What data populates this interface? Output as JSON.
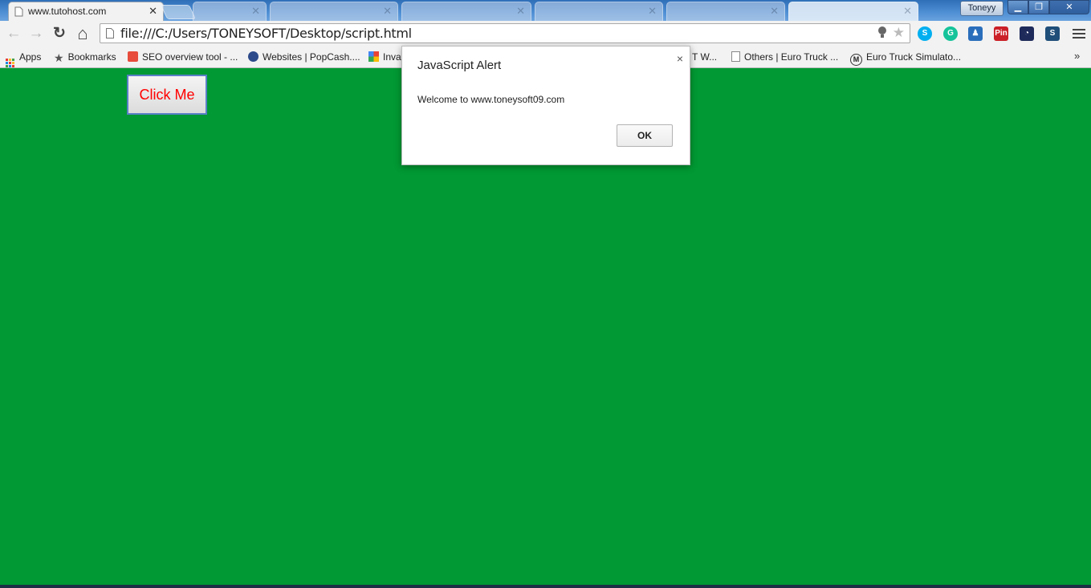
{
  "window": {
    "profile_name": "Toneyy",
    "minimize_symbol": "▁",
    "maximize_symbol": "❐",
    "close_symbol": "✕"
  },
  "tabs": [
    {
      "title": "www.tutohost.com",
      "active": true
    },
    {
      "title": "",
      "active": false
    },
    {
      "title": "",
      "active": false
    },
    {
      "title": "",
      "active": false
    },
    {
      "title": "",
      "active": false
    },
    {
      "title": "",
      "active": false
    },
    {
      "title": "",
      "active": false
    }
  ],
  "toolbar": {
    "back_symbol": "←",
    "forward_symbol": "→",
    "reload_symbol": "↻",
    "home_symbol": "⌂",
    "url": "file:///C:/Users/TONEYSOFT/Desktop/script.html",
    "bulb_symbol": "💡",
    "star_symbol": "★",
    "extensions": [
      {
        "name": "skype-extension-icon",
        "label": "S",
        "color": "#00aff0"
      },
      {
        "name": "grammarly-extension-icon",
        "label": "G",
        "color": "#15c39a"
      },
      {
        "name": "user-extension-icon",
        "label": "♟",
        "color": "#2a6ebb"
      },
      {
        "name": "pinterest-extension-icon",
        "label": "Pin",
        "color": "#cb2027"
      },
      {
        "name": "speedometer-extension-icon",
        "label": "◔",
        "color": "#1e2a5a"
      },
      {
        "name": "s-extension-icon",
        "label": "S",
        "color": "#1f4e79"
      }
    ]
  },
  "bookmarks": {
    "apps": "Apps",
    "items": [
      {
        "label": "Bookmarks",
        "icon": "star-icon"
      },
      {
        "label": "SEO overview tool - ...",
        "icon": "seo-icon"
      },
      {
        "label": "Websites | PopCash....",
        "icon": "popcash-icon"
      },
      {
        "label": "Inva",
        "icon": "google-icon"
      },
      {
        "label": "T W...",
        "icon": "none"
      },
      {
        "label": "Others | Euro Truck ...",
        "icon": "page-icon"
      },
      {
        "label": "Euro Truck Simulato...",
        "icon": "m-icon"
      }
    ],
    "overflow": "»"
  },
  "page": {
    "background_color": "#009933",
    "button_label": "Click Me",
    "button_text_color": "#ff0000"
  },
  "alert": {
    "title": "JavaScript Alert",
    "message": "Welcome to www.toneysoft09.com",
    "ok_label": "OK",
    "close_symbol": "×"
  }
}
